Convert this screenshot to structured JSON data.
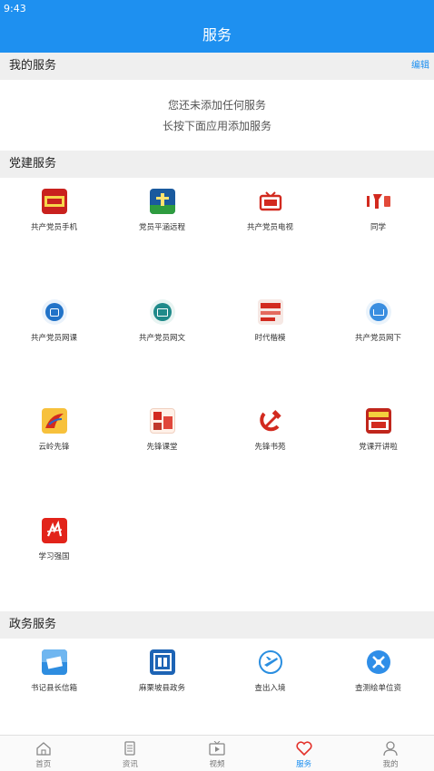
{
  "status_bar": {
    "time": "9:43"
  },
  "header": {
    "title": "服务"
  },
  "my_services": {
    "title": "我的服务",
    "edit_label": "编辑",
    "empty_line1": "您还未添加任何服务",
    "empty_line2": "长按下面应用添加服务"
  },
  "party_services": {
    "title": "党建服务",
    "items": [
      {
        "label": "共产党员手机",
        "icon": "newspaper-logo-icon"
      },
      {
        "label": "党员平涵远程",
        "icon": "satellite-logo-icon"
      },
      {
        "label": "共产党员电视",
        "icon": "tv-icon"
      },
      {
        "label": "同学",
        "icon": "study-logo-icon"
      },
      {
        "label": "共产党员网课",
        "icon": "play-circle-icon"
      },
      {
        "label": "共产党员网文",
        "icon": "document-circle-icon"
      },
      {
        "label": "时代楷模",
        "icon": "role-model-icon"
      },
      {
        "label": "共产党员网下",
        "icon": "download-circle-icon"
      },
      {
        "label": "云岭先锋",
        "icon": "pioneer-bird-icon"
      },
      {
        "label": "先锋课堂",
        "icon": "classroom-icon"
      },
      {
        "label": "先锋书苑",
        "icon": "hammer-sickle-icon"
      },
      {
        "label": "党课开讲啦",
        "icon": "lecture-icon"
      },
      {
        "label": "学习强国",
        "icon": "xuexi-icon"
      }
    ]
  },
  "gov_services": {
    "title": "政务服务",
    "items": [
      {
        "label": "书记县长信箱",
        "icon": "mailbox-icon"
      },
      {
        "label": "麻栗坡县政务",
        "icon": "gov-building-icon"
      },
      {
        "label": "查出入境",
        "icon": "airplane-icon"
      },
      {
        "label": "查测绘单位资",
        "icon": "survey-tools-icon"
      }
    ]
  },
  "tab_bar": {
    "active": "服务",
    "items": [
      {
        "label": "首页",
        "icon": "home-icon"
      },
      {
        "label": "资讯",
        "icon": "news-icon"
      },
      {
        "label": "视频",
        "icon": "video-icon"
      },
      {
        "label": "服务",
        "icon": "heart-icon"
      },
      {
        "label": "我的",
        "icon": "user-icon"
      }
    ]
  },
  "colors": {
    "primary": "#1e90f0",
    "section_bg": "#efefef",
    "party_red": "#d22a1f"
  }
}
